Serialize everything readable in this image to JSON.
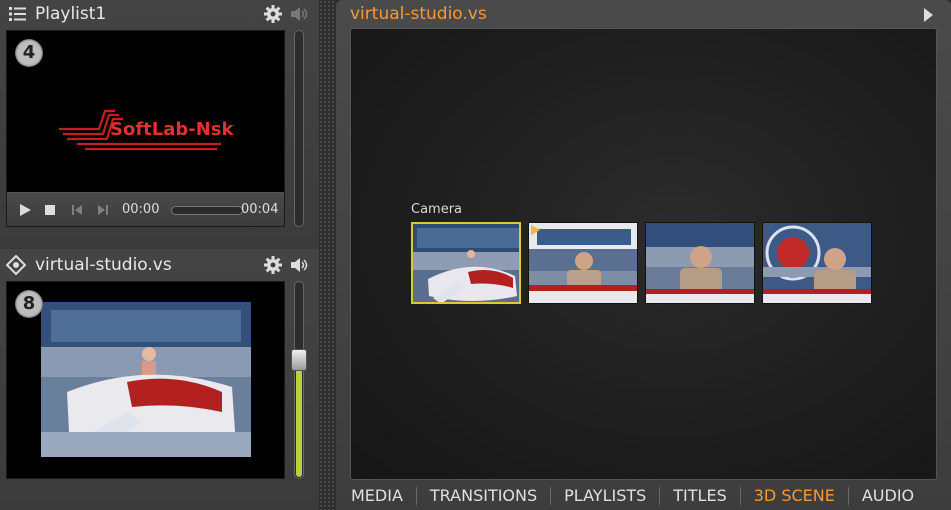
{
  "playlist_panel": {
    "title": "Playlist1",
    "badge": "4",
    "logo_text": "SoftLab-Nsk",
    "time_current": "00:00",
    "time_total": "00:04",
    "progress": 0
  },
  "scene_panel": {
    "title": "virtual-studio.vs",
    "badge": "8",
    "volume_level": 0.6
  },
  "main": {
    "title": "virtual-studio.vs",
    "camera_label": "Camera",
    "selected_camera": 0,
    "camera_count": 4
  },
  "tabs": [
    {
      "label": "MEDIA",
      "active": false
    },
    {
      "label": "TRANSITIONS",
      "active": false
    },
    {
      "label": "PLAYLISTS",
      "active": false
    },
    {
      "label": "TITLES",
      "active": false
    },
    {
      "label": "3D SCENE",
      "active": true
    },
    {
      "label": "AUDIO",
      "active": false
    }
  ],
  "colors": {
    "accent": "#f59a3c",
    "selection": "#d8cc33",
    "volume": "#b8d23a"
  },
  "icons": {
    "playlist": "list-icon",
    "scene": "diamond-icon",
    "settings": "gear-icon",
    "audio": "speaker-icon"
  }
}
